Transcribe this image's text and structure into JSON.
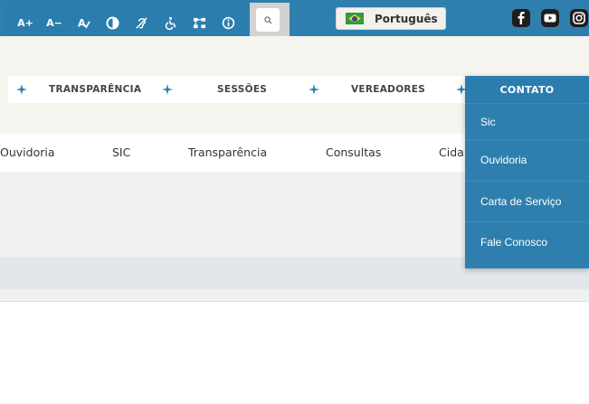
{
  "accessibility": {
    "increase_font": "A+",
    "decrease_font": "A−"
  },
  "language": {
    "label": "Português"
  },
  "nav": {
    "items": [
      "TRANSPARÊNCIA",
      "SESSÕES",
      "VEREADORES"
    ],
    "active": "CONTATO"
  },
  "subnav": {
    "items": [
      "Ouvidoria",
      "SIC",
      "Transparência",
      "Consultas",
      "Cida"
    ]
  },
  "dropdown": {
    "title": "CONTATO",
    "items": [
      "Sic",
      "Ouvidoria",
      "Carta de Serviço",
      "Fale Conosco"
    ]
  },
  "colors": {
    "primary": "#2e7fae",
    "cream": "#f6f4ee",
    "grey": "#eef0f2"
  },
  "icons": {
    "a11y": [
      "increase-font-icon",
      "decrease-font-icon",
      "dyslexia-font-icon",
      "contrast-icon",
      "hearing-icon",
      "wheelchair-icon",
      "sitemap-icon",
      "info-icon"
    ],
    "search": "search-icon",
    "social": [
      "facebook-icon",
      "youtube-icon",
      "instagram-icon"
    ]
  }
}
